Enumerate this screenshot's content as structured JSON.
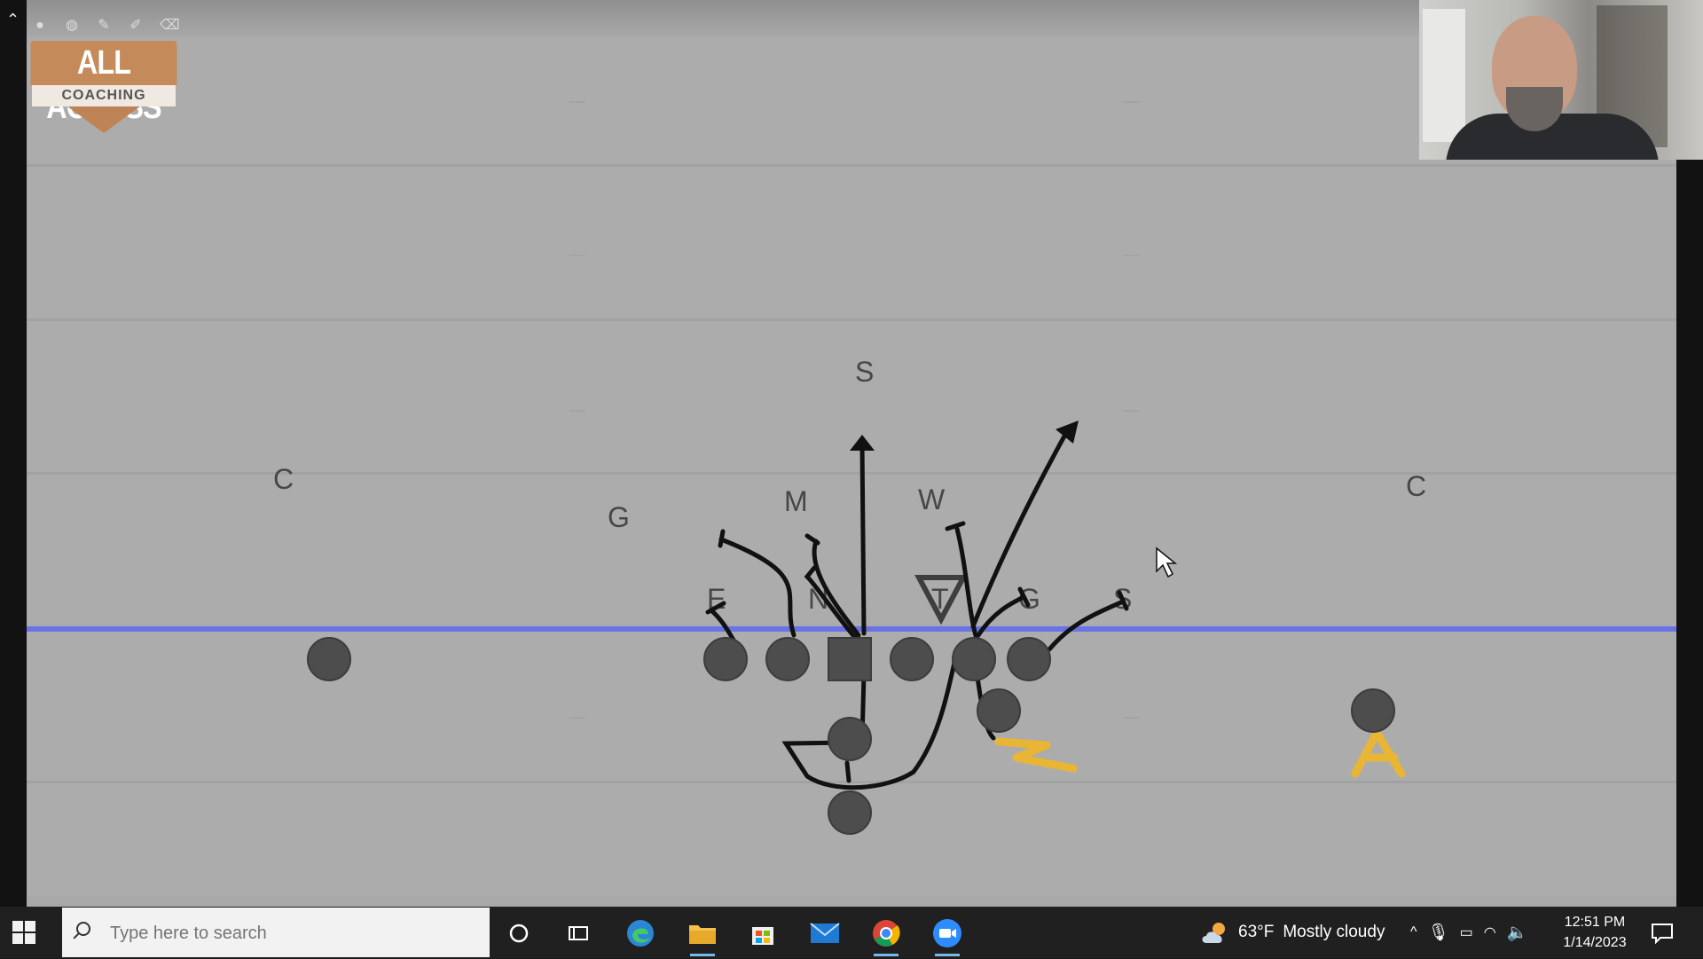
{
  "branding": {
    "logo_main": "ALL ACCESS",
    "logo_sub": "COACHING"
  },
  "colors": {
    "line_of_scrimmage": "#6a73e6",
    "player": "#4d4d4d",
    "route": "#111111",
    "highlight": "#e9b535"
  },
  "defense_labels": {
    "safety_deep": "S",
    "corner_left": "C",
    "corner_right": "C",
    "mike": "M",
    "will": "W",
    "g_left": "G",
    "end": "E",
    "nose": "N",
    "tackle": "T",
    "g_right": "G",
    "s_right": "S"
  },
  "taskbar": {
    "search_placeholder": "Type here to search",
    "weather_temp": "63°F",
    "weather_desc": "Mostly cloudy",
    "time": "12:51 PM",
    "date": "1/14/2023",
    "apps": [
      "cortana-icon",
      "task-view-icon",
      "edge-icon",
      "file-explorer-icon",
      "store-icon",
      "mail-icon",
      "chrome-icon",
      "zoom-icon"
    ]
  }
}
